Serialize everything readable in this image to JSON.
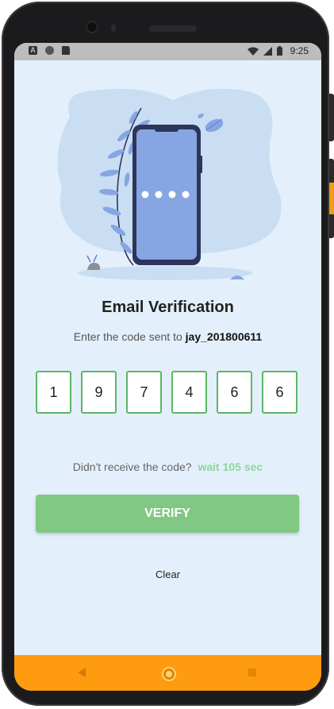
{
  "status_bar": {
    "left_icons": [
      "a-icon",
      "circle-icon",
      "sd-card-icon"
    ],
    "time": "9:25",
    "right_icons": [
      "wifi-icon",
      "signal-icon",
      "battery-icon"
    ]
  },
  "illustration": {
    "description_icons": [
      "phone-icon",
      "leaf-icon"
    ]
  },
  "main": {
    "title": "Email Verification",
    "subtitle_prefix": "Enter the code sent to",
    "subtitle_user": "jay_201800611",
    "code_digits": [
      "1",
      "9",
      "7",
      "4",
      "6",
      "6"
    ],
    "resend_prefix": "Didn't receive the code?",
    "resend_wait": "wait 105 sec",
    "verify_label": "VERIFY",
    "clear_label": "Clear"
  },
  "nav_bar": {
    "buttons": [
      "back-icon",
      "home-icon",
      "recent-apps-icon"
    ]
  },
  "colors": {
    "background": "#e3f0fb",
    "accent_green": "#80c883",
    "box_border": "#5cb764",
    "wait_text": "#8fd59a",
    "nav_bar": "#ff9b0f"
  }
}
